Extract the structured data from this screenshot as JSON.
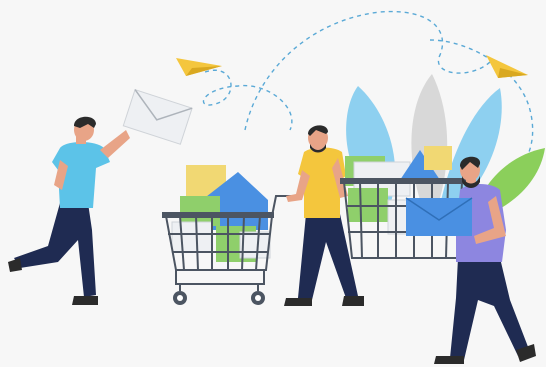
{
  "scene": {
    "subject": "email-marketing-illustration",
    "people_count": 3,
    "colors": {
      "background": "#f7f7f7",
      "skin": "#e8a487",
      "hair": "#2b2b2b",
      "navy": "#1f2b52",
      "shirt_cyan": "#5cc3e8",
      "shirt_yellow": "#f4c63d",
      "shirt_purple": "#8d86e0",
      "envelope_blue": "#4a90e2",
      "envelope_yellow": "#f1d873",
      "envelope_green": "#8fcf6b",
      "envelope_white": "#eef0f3",
      "plane": "#f4c63d",
      "leaf_blue": "#8ed0f0",
      "leaf_green": "#8bcf5b",
      "leaf_grey": "#d8d8d8",
      "dash": "#5aa9d6",
      "cart": "#4c5562"
    },
    "icons": [
      "envelope-icon",
      "paper-plane-icon",
      "shopping-cart-icon",
      "leaf-icon"
    ]
  }
}
